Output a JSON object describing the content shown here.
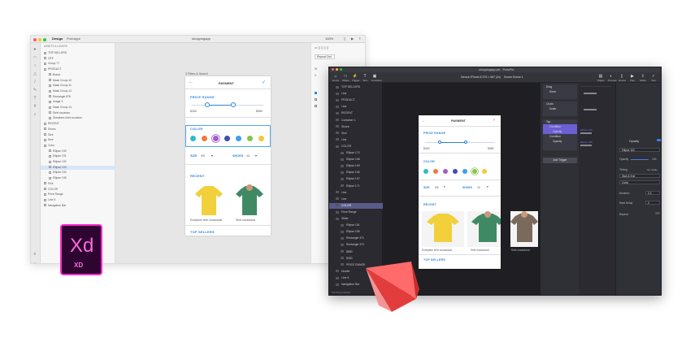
{
  "xd": {
    "tabs": [
      "Design",
      "Prototype"
    ],
    "title": "shoppingapp",
    "zoom": "100%",
    "assets_header": "ASSETS & LAYERS",
    "layers": [
      "TOP SELLERS",
      "OFF",
      "Group 77",
      "PRODUCT",
      "Brand",
      "Mask Group 10",
      "Mask Group 11",
      "Mask Group 12",
      "Rectangle 878",
      "Image 3",
      "Mask Group 14",
      "Shirt occasion",
      "Sneakers shirt occasion",
      "RECENT",
      "Shoes",
      "Size",
      "Size",
      "Color",
      "Ellipse 190",
      "Ellipse 191",
      "Ellipse 192",
      "Ellipse 193",
      "Ellipse 194",
      "Ellipse 195",
      "Pick",
      "COLOR",
      "Price Range",
      "Line 5",
      "Navigation Bar"
    ],
    "selected_layer": 21,
    "artboard_label": "3 Filters & Search",
    "props": {
      "tab": "Repeat Grid",
      "w": "W",
      "h": "H",
      "x": "X",
      "y": "Y"
    }
  },
  "app": {
    "header": "PAYMENT",
    "price_range": "PRICE RANGE",
    "price_min": "$300",
    "price_max": "$980",
    "color": "COLOR",
    "size_label": "SIZE",
    "size_value": "XS",
    "shoes_label": "SHOES",
    "shoes_value": "12",
    "recent": "RECENT",
    "items": [
      {
        "caption": "Exception shirt occasional",
        "color": "#f2d03b"
      },
      {
        "caption": "Shirt occasional",
        "color": "#3f8a64"
      },
      {
        "caption": "Shirt occasional",
        "color": "#7a6a5c"
      }
    ],
    "top_sellers": "TOP SELLERS",
    "swatch_colors": [
      "#2bbec6",
      "#f07a3a",
      "#a35dc9",
      "#3b4fb4",
      "#3ba0e8",
      "#86c44c",
      "#f2c840"
    ]
  },
  "pp": {
    "title": "shoppingapp.pie - ProtoPie",
    "toolbar": [
      "Home",
      "Shape",
      "Trigger",
      "Text",
      "Container"
    ],
    "right_tools": [
      "Pages",
      "Preview",
      "Device",
      "Play",
      "Share",
      "Test"
    ],
    "device": "Device   iPhone 8 375 × 667 (2x)",
    "scene": "Scene   Scene 1",
    "layers": [
      "TOP SELLERS",
      "Line",
      "PRODUCT",
      "Line",
      "RECENT",
      "Container 1",
      "Shoes",
      "Size",
      "Line",
      "COLOR",
      "Ellipse 170",
      "Ellipse 168",
      "Ellipse 169",
      "Ellipse 166",
      "Ellipse 167",
      "Ellipse 171",
      "Line",
      "Line",
      "COLOR",
      "Price Range",
      "Slider",
      "Ellipse 181",
      "Ellipse 180",
      "Rectangle 371",
      "Rectangle 370",
      "$880",
      "$300",
      "PRICE RANGE",
      "Divider",
      "Line 5",
      "Navigation Bar"
    ],
    "selected_layer": 18,
    "bottom": "Scrolling enabled",
    "interactions": [
      {
        "trigger": "Drag",
        "responses": [
          "Move"
        ]
      },
      {
        "trigger": "Chain",
        "responses": [
          "Scale"
        ]
      },
      {
        "trigger": "Tap",
        "responses": [
          "Condition",
          "Opacity",
          "Condition",
          "Opacity"
        ]
      }
    ],
    "add_trigger": "Add Trigger",
    "timeline_labels": [
      "Ellipse 166",
      "Ellipse 168",
      "Ellipse 170"
    ],
    "props": {
      "response": "Opacity",
      "target": "Ellipse 160",
      "opacity_label": "Opacity",
      "opacity_value": "100",
      "timing": "Timing",
      "timing_hint": "Ck. Scale",
      "reverse": "Start & End",
      "curve": "Cubic",
      "duration_label": "Duration",
      "duration_value": "0.3",
      "start_label": "Start Delay",
      "start_value": "0",
      "repeat_label": "Repeat"
    }
  },
  "logos": {
    "xd_big": "Xd",
    "xd_small": "XD"
  },
  "colors": {
    "pie": "#f24b4b",
    "xd_pink": "#ff29d0",
    "xd_bg": "#2e0430"
  }
}
